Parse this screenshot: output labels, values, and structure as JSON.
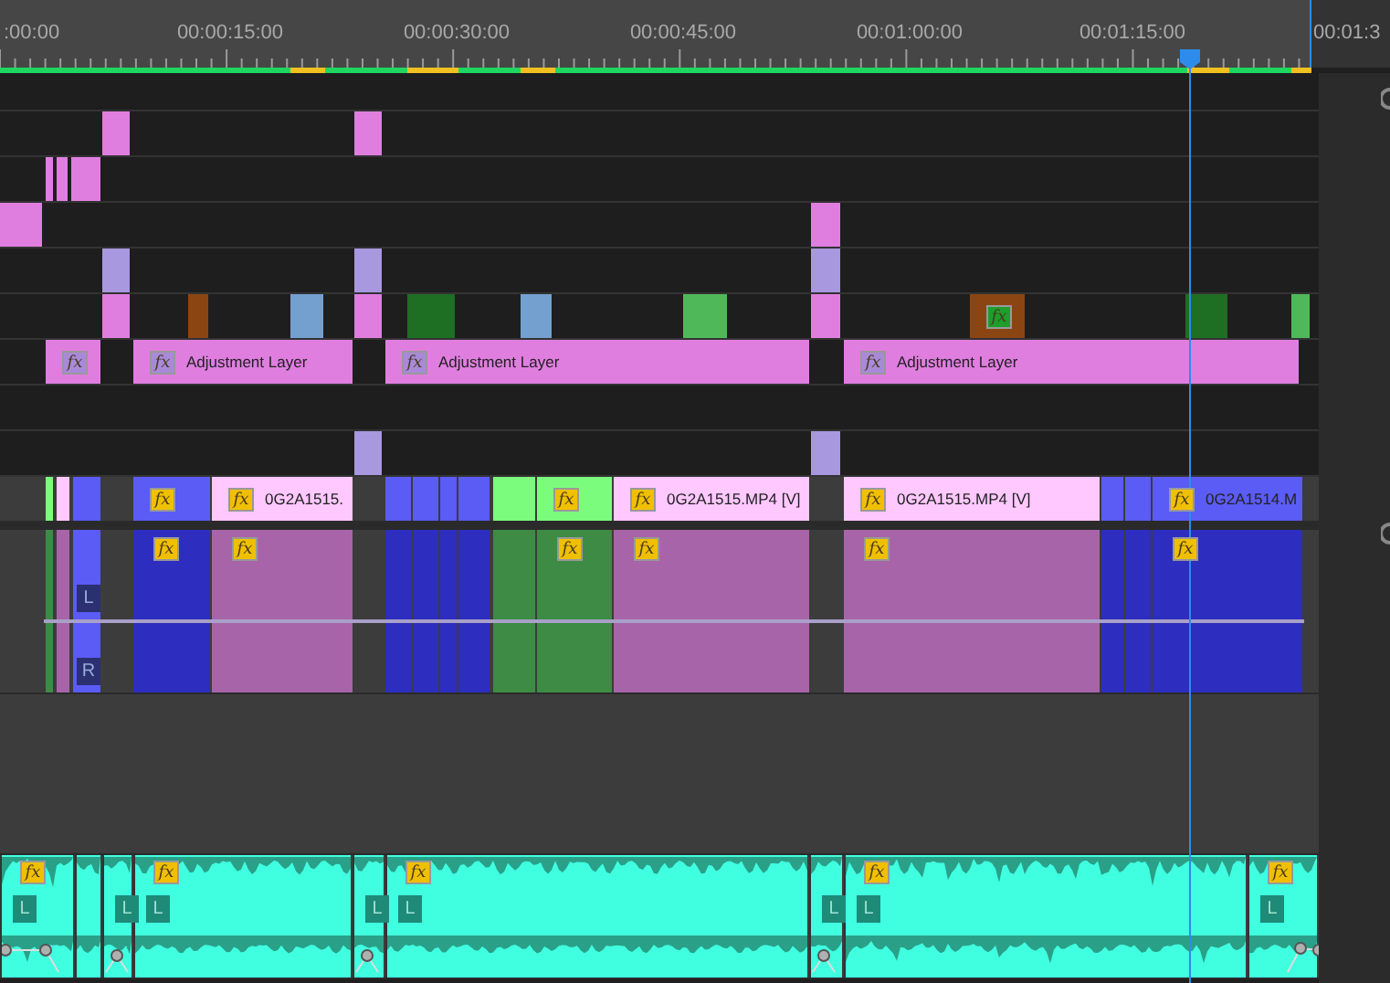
{
  "ruler": {
    "labels": [
      ":00:00",
      "00:00:15:00",
      "00:00:30:00",
      "00:00:45:00",
      "00:01:00:00",
      "00:01:15:00",
      "00:01:3"
    ]
  },
  "tracks": [
    {
      "kind": "video",
      "clips": [
        {
          "color": "#e07ee0"
        },
        {
          "color": "#e07ee0"
        }
      ]
    },
    {
      "kind": "video",
      "clips": [
        {
          "color": "#e07ee0"
        },
        {
          "color": "#e07ee0"
        },
        {
          "color": "#e07ee0"
        }
      ]
    },
    {
      "kind": "video",
      "clips": [
        {
          "color": "#e07ee0"
        },
        {
          "color": "#e07ee0"
        }
      ]
    },
    {
      "kind": "video",
      "clips": [
        {
          "color": "#a898e0"
        },
        {
          "color": "#a898e0"
        },
        {
          "color": "#a898e0"
        }
      ]
    },
    {
      "kind": "video",
      "clips": [
        {
          "color": "#e07ee0"
        },
        {
          "color": "#8b4513"
        },
        {
          "color": "#74a0d0"
        },
        {
          "color": "#e07ee0"
        },
        {
          "color": "#1e6e23"
        },
        {
          "color": "#74a0d0"
        },
        {
          "color": "#4fb95a"
        },
        {
          "color": "#e07ee0"
        },
        {
          "color": "#8b4513",
          "badge": {
            "text": "fx",
            "color": "#1e9e2a"
          }
        },
        {
          "color": "#1e6e23"
        },
        {
          "color": "#4fb95a"
        }
      ]
    },
    {
      "kind": "video",
      "clips": [
        {
          "color": "#e07ee0",
          "badge": {
            "text": "fx",
            "color": "#a88ad8"
          }
        },
        {
          "color": "#e07ee0",
          "badge": {
            "text": "fx",
            "color": "#a88ad8"
          },
          "label": "Adjustment Layer"
        },
        {
          "color": "#e07ee0",
          "badge": {
            "text": "fx",
            "color": "#a88ad8"
          },
          "label": "Adjustment Layer"
        },
        {
          "color": "#e07ee0",
          "badge": {
            "text": "fx",
            "color": "#a88ad8"
          },
          "label": "Adjustment Layer"
        }
      ]
    },
    {
      "kind": "video",
      "clips": [
        {
          "color": "#a898e0"
        },
        {
          "color": "#a898e0"
        }
      ]
    },
    {
      "kind": "video",
      "clips": [
        {
          "color": "#7cfc7c"
        },
        {
          "color": "#ffc8ff"
        },
        {
          "color": "#5b5bf5"
        },
        {
          "color": "#5b5bf5",
          "badge": {
            "text": "fx",
            "color": "#f0c000"
          }
        },
        {
          "color": "#ffc8ff",
          "badge": {
            "text": "fx",
            "color": "#f0c000"
          },
          "label": "0G2A1515."
        },
        {
          "color": "#5b5bf5"
        },
        {
          "color": "#5b5bf5"
        },
        {
          "color": "#5b5bf5"
        },
        {
          "color": "#5b5bf5"
        },
        {
          "color": "#7cfc7c"
        },
        {
          "color": "#7cfc7c",
          "badge": {
            "text": "fx",
            "color": "#f0c000"
          }
        },
        {
          "color": "#ffc8ff",
          "badge": {
            "text": "fx",
            "color": "#f0c000"
          },
          "label": "0G2A1515.MP4 [V]"
        },
        {
          "color": "#ffc8ff",
          "badge": {
            "text": "fx",
            "color": "#f0c000"
          },
          "label": "0G2A1515.MP4 [V]"
        },
        {
          "color": "#5b5bf5"
        },
        {
          "color": "#5b5bf5"
        },
        {
          "color": "#5b5bf5",
          "badge": {
            "text": "fx",
            "color": "#f0c000"
          },
          "label": "0G2A1514.M"
        }
      ]
    },
    {
      "kind": "stereo",
      "clips": [
        {
          "color": "#3d8b45"
        },
        {
          "color": "#a864a8"
        },
        {
          "color": "#5b5bf5",
          "channels": [
            "L",
            "R"
          ]
        },
        {
          "color": "#2d2dc0",
          "badge": {
            "text": "fx",
            "color": "#f0c000"
          }
        },
        {
          "color": "#a864a8",
          "badge": {
            "text": "fx",
            "color": "#f0c000"
          }
        },
        {
          "color": "#2d2dc0"
        },
        {
          "color": "#2d2dc0"
        },
        {
          "color": "#2d2dc0"
        },
        {
          "color": "#2d2dc0"
        },
        {
          "color": "#3d8b45"
        },
        {
          "color": "#3d8b45",
          "badge": {
            "text": "fx",
            "color": "#f0c000"
          }
        },
        {
          "color": "#a864a8",
          "badge": {
            "text": "fx",
            "color": "#f0c000"
          }
        },
        {
          "color": "#a864a8",
          "badge": {
            "text": "fx",
            "color": "#f0c000"
          }
        },
        {
          "color": "#2d2dc0"
        },
        {
          "color": "#2d2dc0"
        },
        {
          "color": "#2d2dc0",
          "badge": {
            "text": "fx",
            "color": "#f0c000"
          }
        }
      ]
    },
    {
      "kind": "mono",
      "clips": [
        {
          "color": "#40ffe0",
          "badge": {
            "text": "fx",
            "color": "#f0c000"
          },
          "channels": [
            "L"
          ]
        },
        {
          "color": "#40ffe0"
        },
        {
          "color": "#40ffe0",
          "channels": [
            "L"
          ]
        },
        {
          "color": "#40ffe0",
          "badge": {
            "text": "fx",
            "color": "#f0c000"
          },
          "channels": [
            "L"
          ]
        },
        {
          "color": "#40ffe0",
          "channels": [
            "L"
          ]
        },
        {
          "color": "#40ffe0",
          "badge": {
            "text": "fx",
            "color": "#f0c000"
          },
          "channels": [
            "L"
          ]
        },
        {
          "color": "#40ffe0",
          "channels": [
            "L"
          ]
        },
        {
          "color": "#40ffe0",
          "badge": {
            "text": "fx",
            "color": "#f0c000"
          },
          "channels": [
            "L"
          ]
        },
        {
          "color": "#40ffe0",
          "badge": {
            "text": "fx",
            "color": "#f0c000"
          },
          "channels": [
            "L"
          ]
        }
      ]
    }
  ]
}
